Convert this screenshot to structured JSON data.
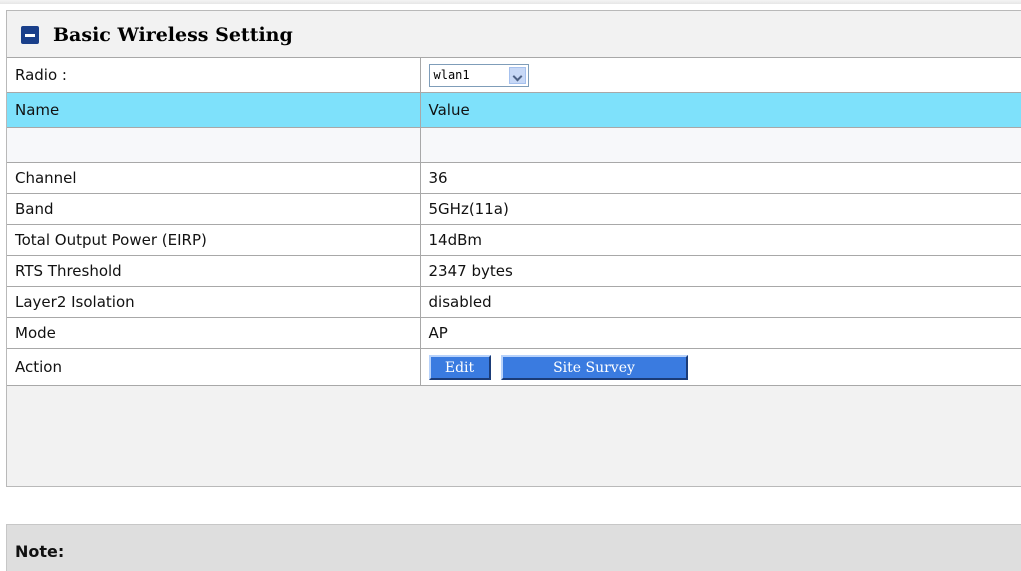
{
  "panel": {
    "title": "Basic Wireless Setting",
    "icon": "collapse-minus-icon"
  },
  "radio": {
    "label": "Radio :",
    "selected": "wlan1"
  },
  "table": {
    "header_name": "Name",
    "header_value": "Value",
    "rows": [
      {
        "name": "",
        "value": ""
      },
      {
        "name": "Channel",
        "value": "36"
      },
      {
        "name": "Band",
        "value": "5GHz(11a)"
      },
      {
        "name": "Total Output Power (EIRP)",
        "value": "14dBm"
      },
      {
        "name": "RTS Threshold",
        "value": "2347 bytes"
      },
      {
        "name": "Layer2 Isolation",
        "value": "disabled"
      },
      {
        "name": "Mode",
        "value": "AP"
      }
    ],
    "action_label": "Action"
  },
  "buttons": {
    "edit": "Edit",
    "site_survey": "Site Survey"
  },
  "note": {
    "label": "Note:"
  },
  "colors": {
    "header_bg": "#7ee1fb",
    "button_bg": "#3a7be0",
    "icon_bg": "#1a3f8a"
  }
}
